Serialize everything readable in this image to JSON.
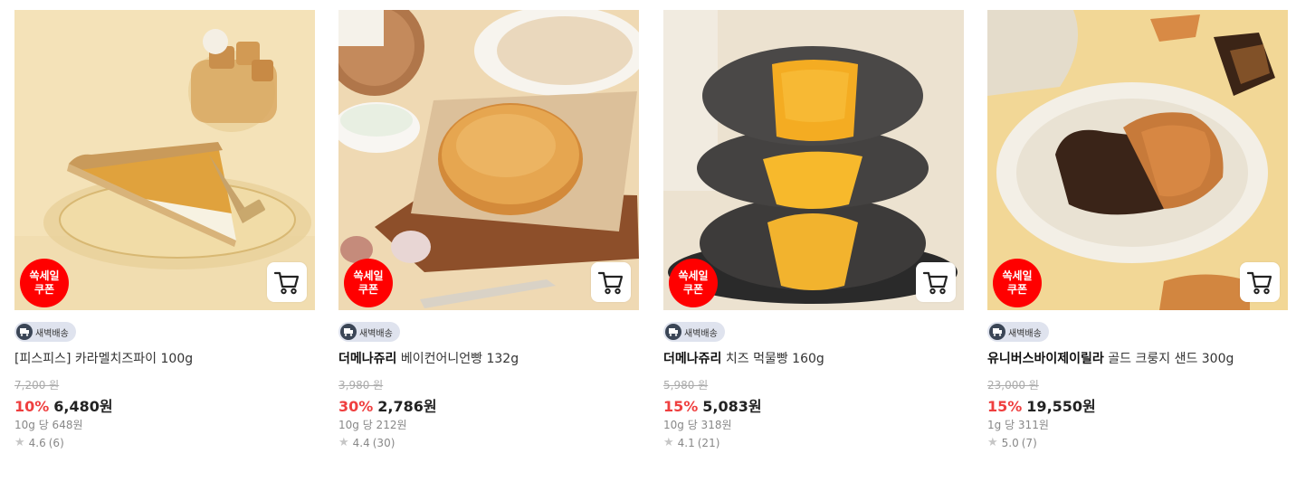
{
  "labels": {
    "sale_line1": "쏙세일",
    "sale_line2": "쿠폰",
    "dawn_delivery": "새벽배송"
  },
  "colors": {
    "sale_badge": "#ff0000",
    "discount_text": "#ef3f3f",
    "tag_bg": "#dfe3ee"
  },
  "icons": {
    "cart": "cart-icon",
    "truck": "truck-icon",
    "star": "star-icon"
  },
  "products": [
    {
      "brand": "",
      "name": "[피스피스] 카라멜치즈파이 100g",
      "original_price": "7,200 원",
      "discount": "10%",
      "price": "6,480원",
      "unit_price": "10g 당 648원",
      "rating": "4.6",
      "review_count": "(6)"
    },
    {
      "brand": "더메나쥬리",
      "name": "베이컨어니언빵 132g",
      "original_price": "3,980 원",
      "discount": "30%",
      "price": "2,786원",
      "unit_price": "10g 당 212원",
      "rating": "4.4",
      "review_count": "(30)"
    },
    {
      "brand": "더메나쥬리",
      "name": "치즈 먹물빵 160g",
      "original_price": "5,980 원",
      "discount": "15%",
      "price": "5,083원",
      "unit_price": "10g 당 318원",
      "rating": "4.1",
      "review_count": "(21)"
    },
    {
      "brand": "유니버스바이제이릴라",
      "name": "골드 크룽지 샌드 300g",
      "original_price": "23,000 원",
      "discount": "15%",
      "price": "19,550원",
      "unit_price": "1g 당 311원",
      "rating": "5.0",
      "review_count": "(7)"
    }
  ]
}
